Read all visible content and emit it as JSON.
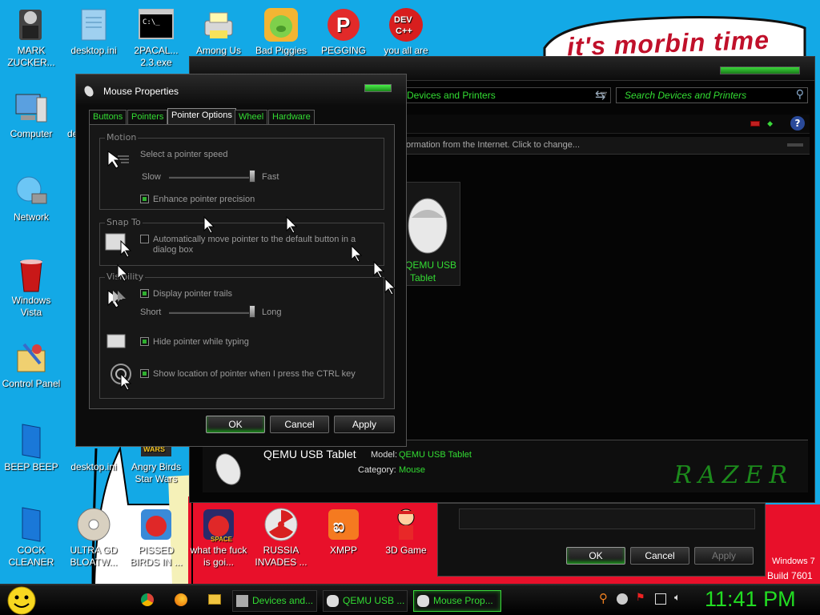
{
  "desktop": {
    "banner_text": "it's morbin time",
    "watermark_line1": "Windows 7",
    "watermark_line2": "Build 7601",
    "icons": [
      {
        "label": "MARK ZUCKER...",
        "icon": "person-icon"
      },
      {
        "label": "desktop.ini",
        "icon": "file-icon"
      },
      {
        "label": "2PACAL... 2.3.exe",
        "icon": "console-icon"
      },
      {
        "label": "Among Us",
        "icon": "printer-icon"
      },
      {
        "label": "Bad Piggies",
        "icon": "pig-icon"
      },
      {
        "label": "PEGGING",
        "icon": "p-logo-icon"
      },
      {
        "label": "you all are",
        "icon": "dev-cpp-icon"
      },
      {
        "label": "Computer",
        "icon": "computer-icon"
      },
      {
        "label": "de",
        "icon": "file-icon"
      },
      {
        "label": "Network",
        "icon": "network-icon"
      },
      {
        "label": "Windows Vista",
        "icon": "recycle-bin-icon"
      },
      {
        "label": "Control Panel",
        "icon": "control-panel-icon"
      },
      {
        "label": "BEEP BEEP",
        "icon": "blue-book-icon"
      },
      {
        "label": "desktop.ini",
        "icon": "file-icon"
      },
      {
        "label": "Angry Birds Star Wars",
        "icon": "star-wars-icon"
      },
      {
        "label": "COCK CLEANER",
        "icon": "blue-book-icon"
      },
      {
        "label": "ULTRA GD BLOATW...",
        "icon": "disc-icon"
      },
      {
        "label": "PISSED BIRDS IN ...",
        "icon": "angry-bird-icon"
      },
      {
        "label": "what the fuck is goi...",
        "icon": "angry-bird-space-icon"
      },
      {
        "label": "RUSSIA INVADES ...",
        "icon": "radiation-icon"
      },
      {
        "label": "XMPP",
        "icon": "xampp-icon"
      },
      {
        "label": "3D Game",
        "icon": "character-icon"
      }
    ]
  },
  "devices_window": {
    "address": "Devices and Printers",
    "search_placeholder": "Search Devices and Printers",
    "info_bar": "ormation from the Internet. Click to change...",
    "device_label_line1": "QEMU USB",
    "device_label_line2": "Tablet",
    "details_name": "QEMU USB Tablet",
    "model_label": "Model:",
    "model_value": "QEMU USB Tablet",
    "category_label": "Category:",
    "category_value": "Mouse",
    "brand": "RAZER"
  },
  "qemu_dialog": {
    "ok": "OK",
    "cancel": "Cancel",
    "apply": "Apply"
  },
  "mouse_dialog": {
    "title": "Mouse Properties",
    "tabs": [
      "Buttons",
      "Pointers",
      "Pointer Options",
      "Wheel",
      "Hardware"
    ],
    "motion": {
      "title": "Motion",
      "speed_label": "Select a pointer speed",
      "slow": "Slow",
      "fast": "Fast",
      "speed_level": 1.0,
      "enhance": "Enhance pointer precision",
      "enhance_checked": true
    },
    "snap": {
      "title": "Snap To",
      "line1": "Automatically move pointer to the default button in a",
      "line2": "dialog box",
      "checked": false
    },
    "visibility": {
      "title": "Visibility",
      "trails": "Display pointer trails",
      "trails_checked": true,
      "short": "Short",
      "long": "Long",
      "trail_level": 1.0,
      "hide": "Hide pointer while typing",
      "hide_checked": true,
      "show": "Show location of pointer when I press the CTRL key",
      "show_checked": true
    },
    "ok": "OK",
    "cancel": "Cancel",
    "apply": "Apply"
  },
  "taskbar": {
    "tasks": [
      "Devices and...",
      "QEMU USB ...",
      "Mouse Prop..."
    ],
    "clock": "11:41 PM"
  }
}
